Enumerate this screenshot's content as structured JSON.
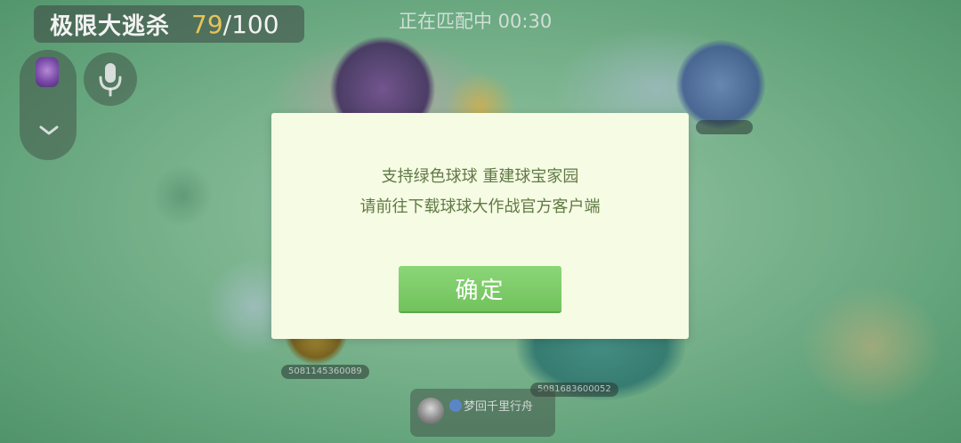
{
  "header": {
    "mode_title": "极限大逃杀",
    "players_current": "79",
    "players_total": "/100",
    "matching_status": "正在匹配中 00:30"
  },
  "player_tags": [
    "5081145360089",
    "5081683600052",
    ""
  ],
  "chat": {
    "message": "梦回千里行舟"
  },
  "dialog": {
    "line1": "支持绿色球球 重建球宝家园",
    "line2": "请前往下载球球大作战官方客户端",
    "confirm_label": "确定"
  },
  "icons": {
    "mic": "microphone-icon",
    "chevron": "chevron-down-icon",
    "emblem": "team-emblem-icon"
  },
  "colors": {
    "dialog_bg": "#f6fbe3",
    "dialog_text": "#5f7a45",
    "confirm_button": "#7bcb66",
    "player_count_highlight": "#e8c35a"
  }
}
